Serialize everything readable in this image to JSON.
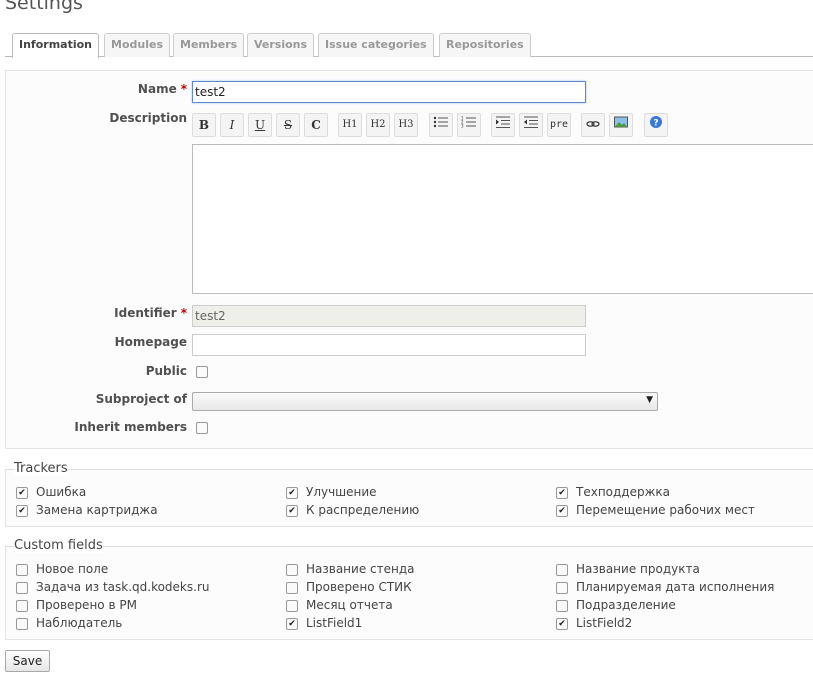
{
  "page_title": "Settings",
  "tabs": [
    "Information",
    "Modules",
    "Members",
    "Versions",
    "Issue categories",
    "Repositories"
  ],
  "form": {
    "name_label": "Name",
    "name_value": "test2",
    "description_label": "Description",
    "identifier_label": "Identifier",
    "identifier_value": "test2",
    "homepage_label": "Homepage",
    "homepage_value": "",
    "public_label": "Public",
    "subproject_label": "Subproject of",
    "subproject_value": "",
    "inherit_label": "Inherit members",
    "required_marker": "*"
  },
  "toolbar": {
    "bold": "B",
    "italic": "I",
    "underline": "U",
    "strike": "S",
    "code": "C",
    "h1": "H1",
    "h2": "H2",
    "h3": "H3",
    "pre": "pre"
  },
  "trackers": {
    "legend": "Trackers",
    "items": [
      {
        "label": "Ошибка",
        "checked": true
      },
      {
        "label": "Улучшение",
        "checked": true
      },
      {
        "label": "Техподдержка",
        "checked": true
      },
      {
        "label": "Замена картриджа",
        "checked": true
      },
      {
        "label": "К распределению",
        "checked": true
      },
      {
        "label": "Перемещение рабочих мест",
        "checked": true
      }
    ]
  },
  "custom_fields": {
    "legend": "Custom fields",
    "items": [
      {
        "label": "Новое поле",
        "checked": false
      },
      {
        "label": "Название стенда",
        "checked": false
      },
      {
        "label": "Название продукта",
        "checked": false
      },
      {
        "label": "Задача из task.qd.kodeks.ru",
        "checked": false
      },
      {
        "label": "Проверено СТИК",
        "checked": false
      },
      {
        "label": "Планируемая дата исполнения",
        "checked": false
      },
      {
        "label": "Проверено в РМ",
        "checked": false
      },
      {
        "label": "Месяц отчета",
        "checked": false
      },
      {
        "label": "Подразделение",
        "checked": false
      },
      {
        "label": "Наблюдатель",
        "checked": false
      },
      {
        "label": "ListField1",
        "checked": true
      },
      {
        "label": "ListField2",
        "checked": true
      }
    ]
  },
  "save_label": "Save",
  "colors": {
    "required": "#bb0000",
    "focus_border": "#5f8cc9"
  }
}
